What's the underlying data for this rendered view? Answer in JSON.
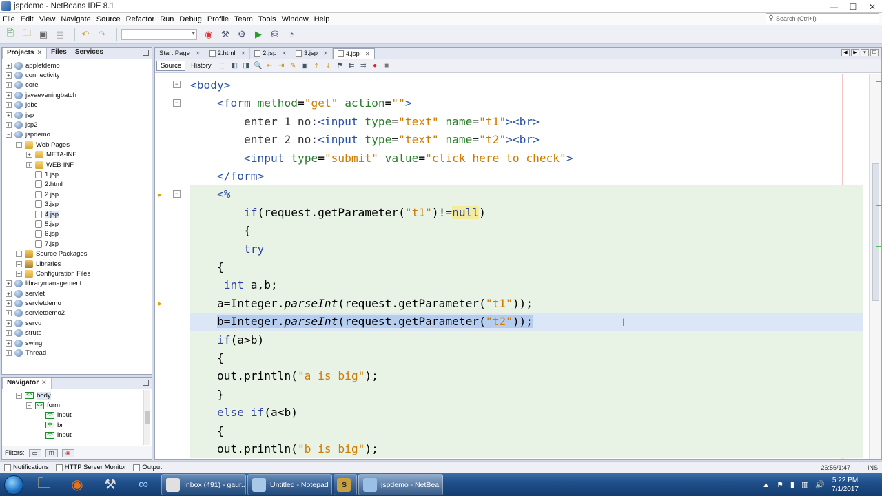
{
  "window": {
    "title": "jspdemo - NetBeans IDE 8.1",
    "controls": [
      "—",
      "☐",
      "✕"
    ]
  },
  "menu": [
    "File",
    "Edit",
    "View",
    "Navigate",
    "Source",
    "Refactor",
    "Run",
    "Debug",
    "Profile",
    "Team",
    "Tools",
    "Window",
    "Help"
  ],
  "search": {
    "placeholder": "Search (Ctrl+I)"
  },
  "projects_panel": {
    "tabs": [
      "Projects",
      "Files",
      "Services"
    ],
    "tree": [
      {
        "label": "appletdemo",
        "level": 0,
        "icon": "globe",
        "exp": "+"
      },
      {
        "label": "connectivity",
        "level": 0,
        "icon": "globe",
        "exp": "+"
      },
      {
        "label": "core",
        "level": 0,
        "icon": "globe",
        "exp": "+"
      },
      {
        "label": "javaeveningbatch",
        "level": 0,
        "icon": "globe",
        "exp": "+"
      },
      {
        "label": "jdbc",
        "level": 0,
        "icon": "globe",
        "exp": "+"
      },
      {
        "label": "jsp",
        "level": 0,
        "icon": "globe",
        "exp": "+"
      },
      {
        "label": "jsp2",
        "level": 0,
        "icon": "globe",
        "exp": "+"
      },
      {
        "label": "jspdemo",
        "level": 0,
        "icon": "globe",
        "exp": "−"
      },
      {
        "label": "Web Pages",
        "level": 1,
        "icon": "folder",
        "exp": "−"
      },
      {
        "label": "META-INF",
        "level": 2,
        "icon": "folder",
        "exp": "+"
      },
      {
        "label": "WEB-INF",
        "level": 2,
        "icon": "folder",
        "exp": "+"
      },
      {
        "label": "1.jsp",
        "level": 2,
        "icon": "file",
        "exp": ""
      },
      {
        "label": "2.html",
        "level": 2,
        "icon": "file",
        "exp": ""
      },
      {
        "label": "2.jsp",
        "level": 2,
        "icon": "file",
        "exp": ""
      },
      {
        "label": "3.jsp",
        "level": 2,
        "icon": "file",
        "exp": ""
      },
      {
        "label": "4.jsp",
        "level": 2,
        "icon": "file",
        "exp": ""
      },
      {
        "label": "5.jsp",
        "level": 2,
        "icon": "file",
        "exp": ""
      },
      {
        "label": "6.jsp",
        "level": 2,
        "icon": "file",
        "exp": ""
      },
      {
        "label": "7.jsp",
        "level": 2,
        "icon": "file",
        "exp": ""
      },
      {
        "label": "Source Packages",
        "level": 1,
        "icon": "pkg",
        "exp": "+"
      },
      {
        "label": "Libraries",
        "level": 1,
        "icon": "lib",
        "exp": "+"
      },
      {
        "label": "Configuration Files",
        "level": 1,
        "icon": "folder",
        "exp": "+"
      },
      {
        "label": "librarymanagement",
        "level": 0,
        "icon": "globe",
        "exp": "+"
      },
      {
        "label": "servlet",
        "level": 0,
        "icon": "globe",
        "exp": "+"
      },
      {
        "label": "servletdemo",
        "level": 0,
        "icon": "globe",
        "exp": "+"
      },
      {
        "label": "servletdemo2",
        "level": 0,
        "icon": "globe",
        "exp": "+"
      },
      {
        "label": "servu",
        "level": 0,
        "icon": "globe",
        "exp": "+"
      },
      {
        "label": "struts",
        "level": 0,
        "icon": "globe",
        "exp": "+"
      },
      {
        "label": "swing",
        "level": 0,
        "icon": "globe",
        "exp": "+"
      },
      {
        "label": "Thread",
        "level": 0,
        "icon": "globe",
        "exp": "+"
      }
    ]
  },
  "navigator": {
    "title": "Navigator",
    "tree": [
      {
        "label": "body",
        "level": 1,
        "exp": "−"
      },
      {
        "label": "form",
        "level": 2,
        "exp": "−"
      },
      {
        "label": "input",
        "level": 3,
        "exp": ""
      },
      {
        "label": "br",
        "level": 3,
        "exp": ""
      },
      {
        "label": "input",
        "level": 3,
        "exp": ""
      }
    ],
    "filters_label": "Filters:"
  },
  "editor": {
    "tabs": [
      {
        "label": "Start Page",
        "active": false
      },
      {
        "label": "2.html",
        "active": false
      },
      {
        "label": "2.jsp",
        "active": false
      },
      {
        "label": "3.jsp",
        "active": false
      },
      {
        "label": "4.jsp",
        "active": true
      }
    ],
    "view_buttons": [
      "Source",
      "History"
    ],
    "lines": [
      "<body>",
      "    <form method=\"get\" action=\"\">",
      "        enter 1 no:<input type=\"text\" name=\"t1\"><br>",
      "        enter 2 no:<input type=\"text\" name=\"t2\"><br>",
      "        <input type=\"submit\" value=\"click here to check\">",
      "    </form>",
      "    <%",
      "        if(request.getParameter(\"t1\")!=null)",
      "        {",
      "        try",
      "    {",
      "     int a,b;",
      "    a=Integer.parseInt(request.getParameter(\"t1\"));",
      "    b=Integer.parseInt(request.getParameter(\"t2\"));",
      "    if(a>b)",
      "    {",
      "    out.println(\"a is big\");",
      "    }",
      "    else if(a<b)",
      "    {",
      "    out.println(\"b is big\");"
    ]
  },
  "statusbar": {
    "items": [
      "Notifications",
      "HTTP Server Monitor",
      "Output"
    ],
    "position": "26:56/1:47",
    "mode": "INS"
  },
  "taskbar": {
    "tasks": [
      {
        "label": "Inbox (491) - gaur...",
        "active": false
      },
      {
        "label": "Untitled - Notepad",
        "active": false
      },
      {
        "label": "S",
        "active": false
      },
      {
        "label": "jspdemo - NetBea...",
        "active": true
      }
    ],
    "time": "5:22 PM",
    "date": "7/1/2017"
  }
}
